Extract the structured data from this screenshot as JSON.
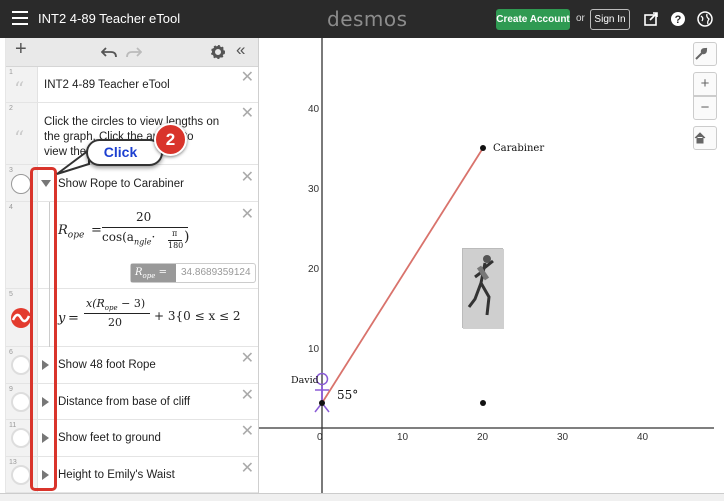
{
  "topbar": {
    "title": "INT2 4-89 Teacher eTool",
    "brand": "desmos",
    "create_account": "Create Account",
    "or": "or",
    "sign_in": "Sign In",
    "icons": [
      "menu-icon",
      "share-icon",
      "help-icon",
      "globe-icon"
    ]
  },
  "toolbar": {
    "icons": [
      "add-icon",
      "undo-icon",
      "redo-icon",
      "settings-icon",
      "collapse-icon"
    ]
  },
  "expressions": [
    {
      "num": "1",
      "kind": "note",
      "text": "INT2 4-89 Teacher eTool"
    },
    {
      "num": "2",
      "kind": "note",
      "text_line1": "Click the circles to view lengths on",
      "text_line2": "the graph. Click the arrows to",
      "text_line3": "view the"
    },
    {
      "num": "3",
      "kind": "folder",
      "text": "Show Rope to Carabiner",
      "expanded": true
    },
    {
      "num": "4",
      "kind": "expression",
      "lhs": "R",
      "lhs_sub": "ope",
      "eq": "=",
      "numer": "20",
      "denom": "cos(a",
      "denom_sub": "ngle",
      "denom_dot": "·",
      "frac_pi": "π",
      "frac_180": "180",
      "eval_label": "R",
      "eval_label_sub": "ope",
      "eval_eq": "=",
      "eval_value": "34.8689359124"
    },
    {
      "num": "5",
      "kind": "expression",
      "lhs": "y",
      "eq": "=",
      "numer": "x(R",
      "numer_sub": "ope",
      "numer_tail": " − 3)",
      "denom": "20",
      "tail": "+ 3{0 ≤ x ≤ 2"
    },
    {
      "num": "6",
      "kind": "folder",
      "text": "Show 48 foot Rope",
      "expanded": false
    },
    {
      "num": "9",
      "kind": "folder",
      "text": "Distance from base of cliff",
      "expanded": false
    },
    {
      "num": "11",
      "kind": "folder",
      "text": "Show feet to ground",
      "expanded": false
    },
    {
      "num": "13",
      "kind": "folder",
      "text": "Height to Emily's Waist",
      "expanded": false
    }
  ],
  "graph": {
    "x_ticks": [
      "0",
      "10",
      "20",
      "30",
      "40"
    ],
    "y_ticks": [
      "10",
      "20",
      "30",
      "40"
    ],
    "labels": {
      "carabiner": "Carabiner",
      "david": "David",
      "angle": "55°"
    },
    "rope_color": "#d9736c",
    "buttons": [
      "wrench-icon",
      "zoom-in-icon",
      "zoom-out-icon",
      "home-icon"
    ],
    "button_text": [
      "+",
      "−"
    ]
  },
  "annotation": {
    "callout": "Click",
    "badge": "2",
    "color": "#d9342b"
  }
}
